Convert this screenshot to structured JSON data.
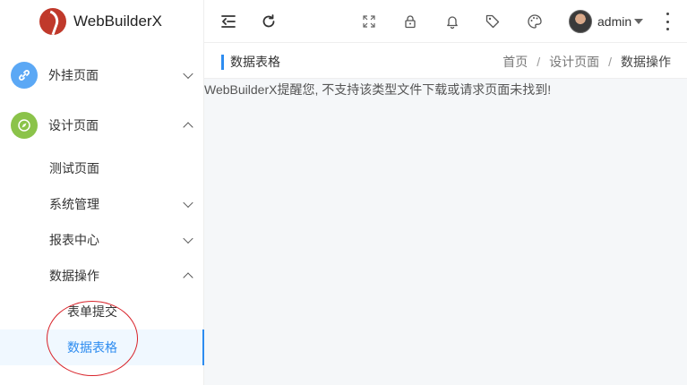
{
  "app": {
    "name": "WebBuilderX"
  },
  "sidebar": {
    "items": [
      {
        "label": "外挂页面",
        "icon": "link-icon",
        "color": "#5ba8f5"
      },
      {
        "label": "设计页面",
        "icon": "compass-icon",
        "color": "#8bc34a"
      }
    ],
    "design_children": [
      {
        "label": "测试页面"
      },
      {
        "label": "系统管理"
      },
      {
        "label": "报表中心"
      },
      {
        "label": "数据操作"
      }
    ],
    "data_children": [
      {
        "label": "表单提交"
      },
      {
        "label": "数据表格"
      }
    ]
  },
  "header": {
    "user": "admin"
  },
  "tagbar": {
    "current": "数据表格"
  },
  "breadcrumb": [
    "首页",
    "设计页面",
    "数据操作"
  ],
  "content": {
    "message": "WebBuilderX提醒您, 不支持该类型文件下载或请求页面未找到!"
  },
  "colors": {
    "accent": "#2d8cf0",
    "annotation": "#d8232a"
  }
}
